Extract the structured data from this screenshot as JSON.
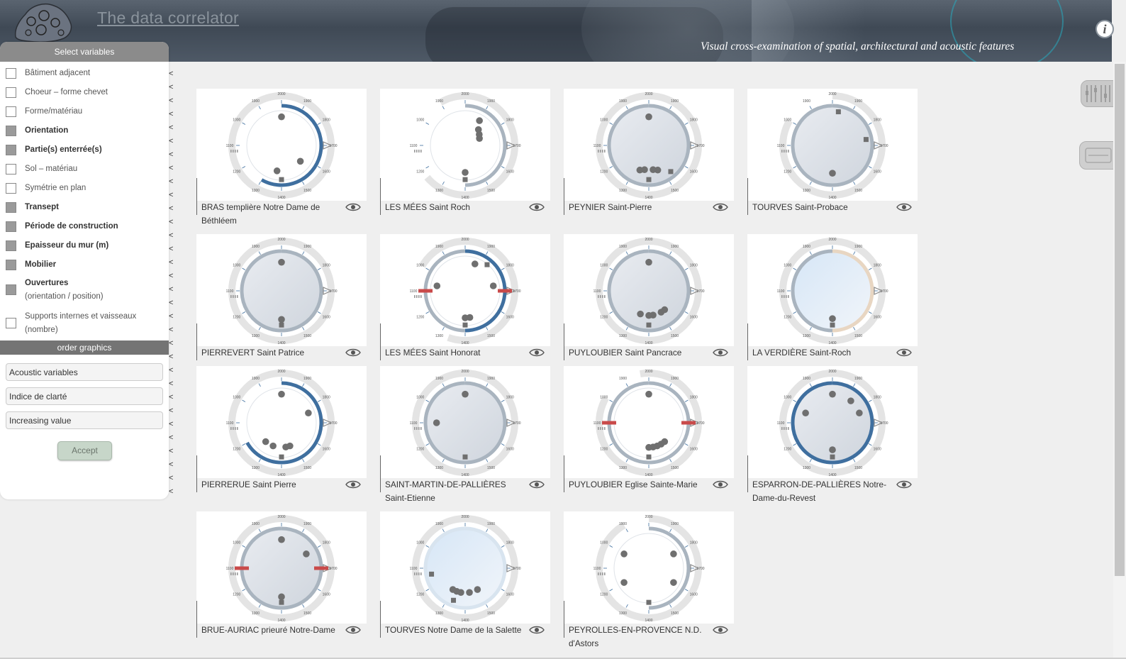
{
  "header": {
    "title": "The data correlator",
    "subtitle": "Visual cross-examination of spatial, architectural and acoustic features",
    "info_label": "i"
  },
  "panel": {
    "select_title": "Select variables",
    "variables": [
      {
        "label": "Bâtiment adjacent",
        "sub": "",
        "checked": false,
        "bold": false
      },
      {
        "label": "Choeur – forme chevet",
        "sub": "",
        "checked": false,
        "bold": false
      },
      {
        "label": "Forme/matériau",
        "sub": "",
        "checked": false,
        "bold": false
      },
      {
        "label": "Orientation",
        "sub": "",
        "checked": true,
        "bold": true
      },
      {
        "label": "Partie(s) enterrée(s)",
        "sub": "",
        "checked": true,
        "bold": true
      },
      {
        "label": "Sol – matériau",
        "sub": "",
        "checked": false,
        "bold": false
      },
      {
        "label": "Symétrie en plan",
        "sub": "",
        "checked": false,
        "bold": false
      },
      {
        "label": "Transept",
        "sub": "",
        "checked": true,
        "bold": true
      },
      {
        "label": "Période de construction",
        "sub": "",
        "checked": true,
        "bold": true
      },
      {
        "label": "Epaisseur du mur (m)",
        "sub": "",
        "checked": true,
        "bold": true
      },
      {
        "label": "Mobilier",
        "sub": "",
        "checked": true,
        "bold": true
      },
      {
        "label": "Ouvertures",
        "sub": "(orientation / position)",
        "checked": true,
        "bold": true
      },
      {
        "label": "Supports internes et vaisseaux",
        "sub": "(nombre)",
        "checked": false,
        "bold": false
      }
    ],
    "order_title": "order graphics",
    "order_fields": [
      "Acoustic variables",
      "Indice de clarté",
      "Increasing value"
    ],
    "accept_label": "Accept"
  },
  "arrow_char": "<",
  "ring_ticks": [
    "2000",
    "1900",
    "1800",
    "1700",
    "1600",
    "1500",
    "1400",
    "1300",
    "1200",
    "1100",
    "1000",
    "1900"
  ],
  "cards": [
    {
      "name": "BRAS templière Notre Dame de Béthléem"
    },
    {
      "name": "LES MÉES Saint Roch"
    },
    {
      "name": "PEYNIER Saint-Pierre"
    },
    {
      "name": "TOURVES Saint-Probace"
    },
    {
      "name": "PIERREVERT Saint Patrice"
    },
    {
      "name": "LES MÉES Saint Honorat"
    },
    {
      "name": "PUYLOUBIER Saint Pancrace"
    },
    {
      "name": "LA VERDIÈRE Saint-Roch"
    },
    {
      "name": "PIERRERUE Saint Pierre"
    },
    {
      "name": "SAINT-MARTIN-DE-PALLIÈRES Saint-Etienne"
    },
    {
      "name": "PUYLOUBIER Eglise Sainte-Marie"
    },
    {
      "name": "ESPARRON-DE-PALLIÈRES Notre-Dame-du-Revest"
    },
    {
      "name": "BRUE-AURIAC prieuré Notre-Dame"
    },
    {
      "name": "TOURVES Notre Dame de la Salette"
    },
    {
      "name": "PEYROLLES-EN-PROVENCE N.D. d'Astors"
    }
  ],
  "colors": {
    "accent_blue": "#3f6f9f",
    "ring_grey": "#a9b4bf",
    "outer_grey": "#e4e4e4",
    "dot_grey": "#6f6f6f",
    "red": "#c94a4a",
    "peach": "#e8d6c2"
  }
}
